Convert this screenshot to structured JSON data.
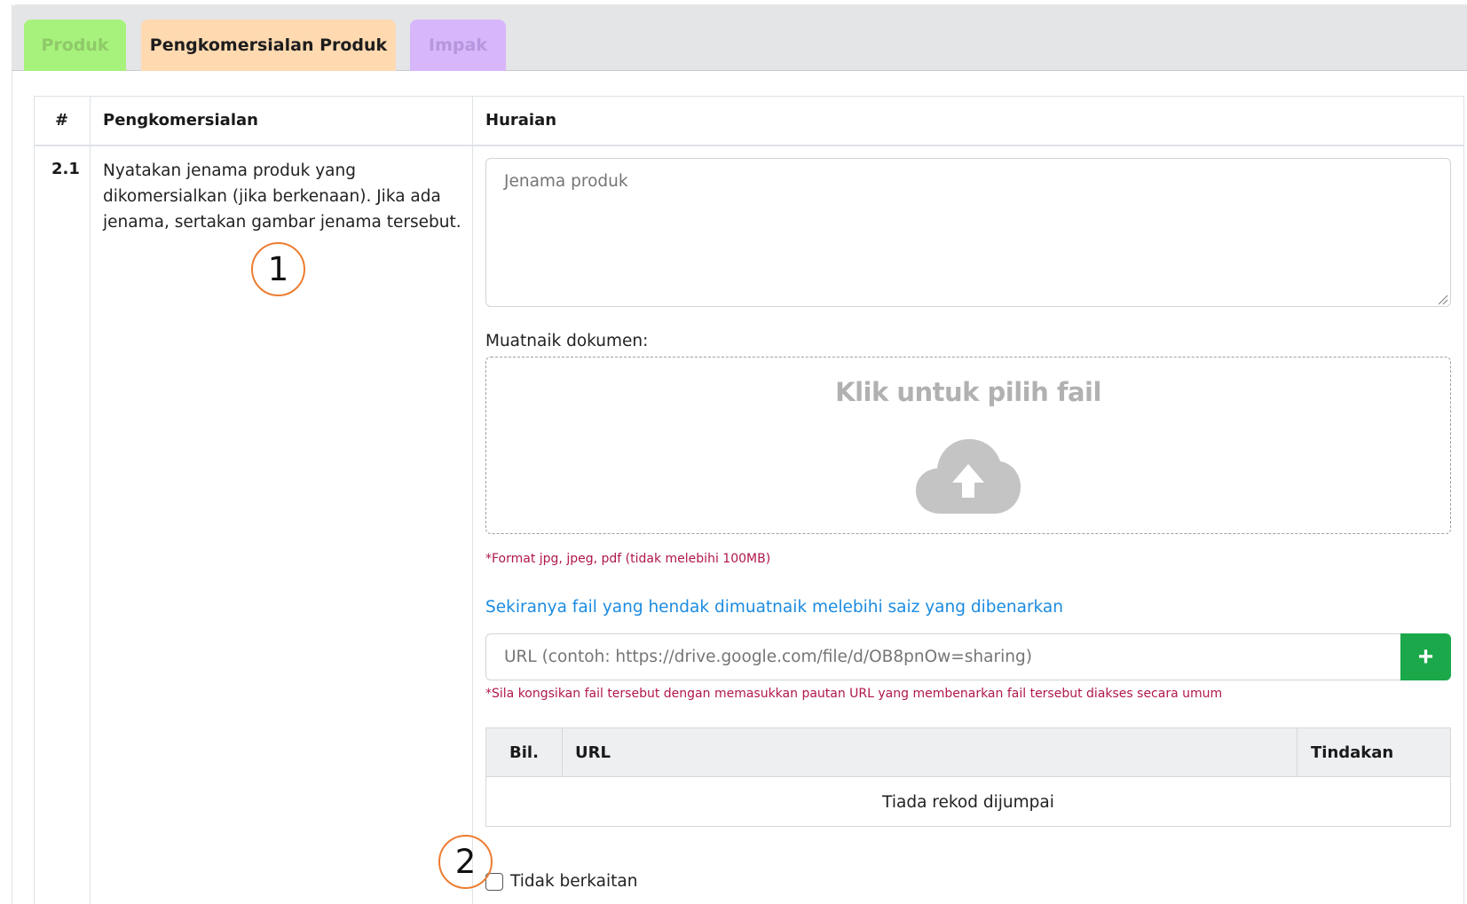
{
  "tabs": [
    {
      "label": "Produk"
    },
    {
      "label": "Pengkomersialan Produk"
    },
    {
      "label": "Impak"
    }
  ],
  "table": {
    "headers": {
      "num": "#",
      "item": "Pengkomersialan",
      "desc": "Huraian"
    },
    "row": {
      "num": "2.1",
      "question": "Nyatakan jenama produk yang dikomersialkan (jika berkenaan). Jika ada jenama, sertakan gambar jenama tersebut."
    }
  },
  "form": {
    "brand_placeholder": "Jenama produk",
    "upload_label": "Muatnaik dokumen:",
    "dropzone_text": "Klik untuk pilih fail",
    "format_hint": "*Format jpg, jpeg, pdf (tidak melebihi 100MB)",
    "oversize_link": "Sekiranya fail yang hendak dimuatnaik melebihi saiz yang dibenarkan",
    "url_placeholder": "URL (contoh: https://drive.google.com/file/d/OB8pnOw=sharing)",
    "add_button": "+",
    "share_hint": "*Sila kongsikan fail tersebut dengan memasukkan pautan URL yang membenarkan fail tersebut diakses secara umum",
    "url_table": {
      "headers": {
        "bil": "Bil.",
        "url": "URL",
        "tindakan": "Tindakan"
      },
      "empty_text": "Tiada rekod dijumpai"
    },
    "not_related_label": "Tidak berkaitan"
  },
  "annotations": [
    "1",
    "2"
  ],
  "colors": {
    "tab_produk": "#a6f27c",
    "tab_pengkomersialan": "#ffd9b0",
    "tab_impak": "#d8b6fb",
    "add_button": "#1aa84a",
    "link": "#1b8be0",
    "hint": "#b0174a",
    "annotation": "#ed7d31"
  },
  "icons": [
    "cloud-upload-icon",
    "plus-icon",
    "resize-grip-icon"
  ]
}
